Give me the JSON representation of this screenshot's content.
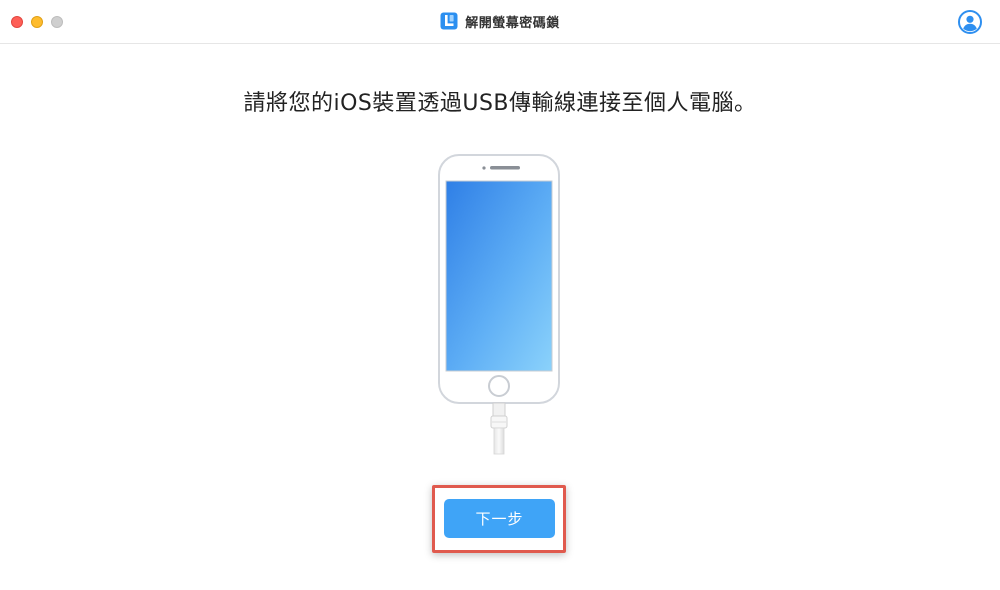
{
  "window": {
    "title": "解開螢幕密碼鎖",
    "app_icon": "app-logo-icon",
    "account_icon": "user-account-icon"
  },
  "main": {
    "instruction": "請將您的iOS裝置透過USB傳輸線連接至個人電腦。",
    "illustration": "iphone-with-usb-cable-icon",
    "next_button_label": "下一步"
  },
  "colors": {
    "accent": "#3fa4f7",
    "highlight_border": "#e05a4e",
    "close_light": "#fe5f57",
    "minimize_light": "#febc2e",
    "inactive_light": "#cfcfcf"
  }
}
